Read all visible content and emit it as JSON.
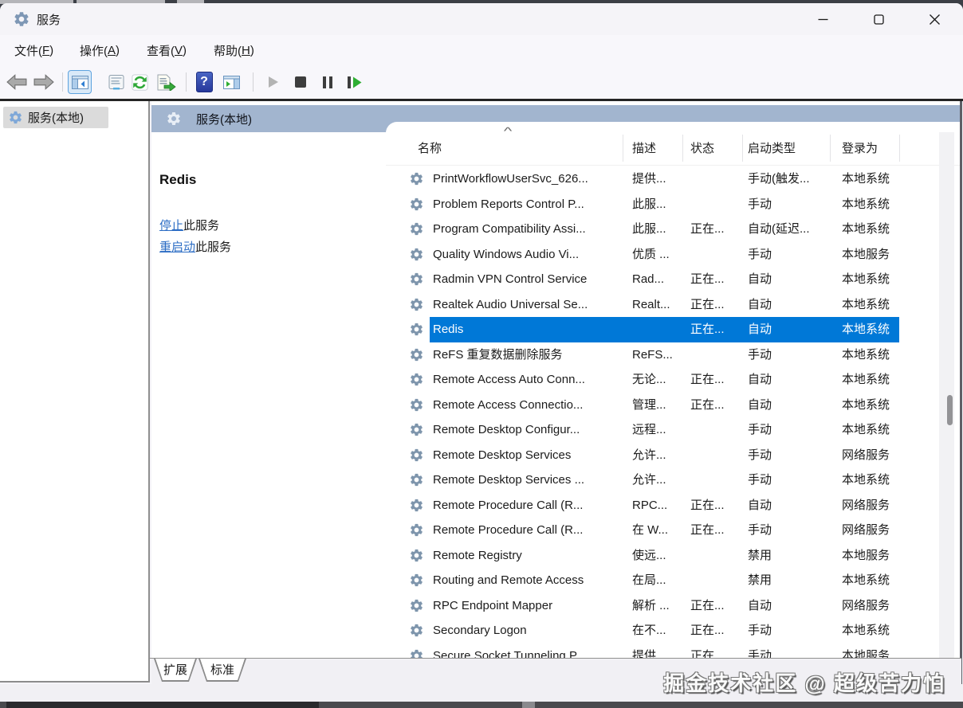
{
  "window": {
    "title": "服务",
    "controls": [
      {
        "name": "minimize"
      },
      {
        "name": "maximize"
      },
      {
        "name": "close"
      }
    ]
  },
  "menu": {
    "items": [
      {
        "pre": "文件(",
        "key": "F",
        "post": ")"
      },
      {
        "pre": "操作(",
        "key": "A",
        "post": ")"
      },
      {
        "pre": "查看(",
        "key": "V",
        "post": ")"
      },
      {
        "pre": "帮助(",
        "key": "H",
        "post": ")"
      }
    ]
  },
  "toolbar": {
    "help_glyph": "?",
    "buttons": [
      {
        "name": "back",
        "enabled": true,
        "pressed": false
      },
      {
        "name": "forward",
        "enabled": true,
        "pressed": false
      },
      {
        "name": "show-console-tree",
        "enabled": true,
        "pressed": true
      },
      {
        "name": "properties",
        "enabled": true,
        "pressed": false
      },
      {
        "name": "refresh",
        "enabled": true,
        "pressed": false
      },
      {
        "name": "export-list",
        "enabled": true,
        "pressed": false
      },
      {
        "name": "help",
        "enabled": true,
        "pressed": false
      },
      {
        "name": "show-action-pane",
        "enabled": true,
        "pressed": false
      },
      {
        "name": "start-service",
        "enabled": false,
        "pressed": false
      },
      {
        "name": "stop-service",
        "enabled": true,
        "pressed": false
      },
      {
        "name": "pause-service",
        "enabled": true,
        "pressed": false
      },
      {
        "name": "restart-service",
        "enabled": true,
        "pressed": false
      }
    ]
  },
  "tree": {
    "root_label": "服务(本地)"
  },
  "pane_header": {
    "title": "服务(本地)"
  },
  "detail": {
    "service_name": "Redis",
    "actions": [
      {
        "link": "停止",
        "suffix": "此服务"
      },
      {
        "link": "重启动",
        "suffix": "此服务"
      }
    ]
  },
  "table": {
    "sort_indicator": "^",
    "columns": [
      "名称",
      "描述",
      "状态",
      "启动类型",
      "登录为"
    ],
    "rows": [
      {
        "name": "PrintWorkflowUserSvc_626...",
        "description": "提供...",
        "status": "",
        "startup_type": "手动(触发...",
        "logon_as": "本地系统",
        "selected": false
      },
      {
        "name": "Problem Reports Control P...",
        "description": "此服...",
        "status": "",
        "startup_type": "手动",
        "logon_as": "本地系统",
        "selected": false
      },
      {
        "name": "Program Compatibility Assi...",
        "description": "此服...",
        "status": "正在...",
        "startup_type": "自动(延迟...",
        "logon_as": "本地系统",
        "selected": false
      },
      {
        "name": "Quality Windows Audio Vi...",
        "description": "优质 ...",
        "status": "",
        "startup_type": "手动",
        "logon_as": "本地服务",
        "selected": false
      },
      {
        "name": "Radmin VPN Control Service",
        "description": "Rad...",
        "status": "正在...",
        "startup_type": "自动",
        "logon_as": "本地系统",
        "selected": false
      },
      {
        "name": "Realtek Audio Universal Se...",
        "description": "Realt...",
        "status": "正在...",
        "startup_type": "自动",
        "logon_as": "本地系统",
        "selected": false
      },
      {
        "name": "Redis",
        "description": "",
        "status": "正在...",
        "startup_type": "自动",
        "logon_as": "本地系统",
        "selected": true
      },
      {
        "name": "ReFS 重复数据删除服务",
        "description": "ReFS...",
        "status": "",
        "startup_type": "手动",
        "logon_as": "本地系统",
        "selected": false
      },
      {
        "name": "Remote Access Auto Conn...",
        "description": "无论...",
        "status": "正在...",
        "startup_type": "自动",
        "logon_as": "本地系统",
        "selected": false
      },
      {
        "name": "Remote Access Connectio...",
        "description": "管理...",
        "status": "正在...",
        "startup_type": "自动",
        "logon_as": "本地系统",
        "selected": false
      },
      {
        "name": "Remote Desktop Configur...",
        "description": "远程...",
        "status": "",
        "startup_type": "手动",
        "logon_as": "本地系统",
        "selected": false
      },
      {
        "name": "Remote Desktop Services",
        "description": "允许...",
        "status": "",
        "startup_type": "手动",
        "logon_as": "网络服务",
        "selected": false
      },
      {
        "name": "Remote Desktop Services ...",
        "description": "允许...",
        "status": "",
        "startup_type": "手动",
        "logon_as": "本地系统",
        "selected": false
      },
      {
        "name": "Remote Procedure Call (R...",
        "description": "RPC...",
        "status": "正在...",
        "startup_type": "自动",
        "logon_as": "网络服务",
        "selected": false
      },
      {
        "name": "Remote Procedure Call (R...",
        "description": "在 W...",
        "status": "正在...",
        "startup_type": "手动",
        "logon_as": "网络服务",
        "selected": false
      },
      {
        "name": "Remote Registry",
        "description": "使远...",
        "status": "",
        "startup_type": "禁用",
        "logon_as": "本地服务",
        "selected": false
      },
      {
        "name": "Routing and Remote Access",
        "description": "在局...",
        "status": "",
        "startup_type": "禁用",
        "logon_as": "本地系统",
        "selected": false
      },
      {
        "name": "RPC Endpoint Mapper",
        "description": "解析 ...",
        "status": "正在...",
        "startup_type": "自动",
        "logon_as": "网络服务",
        "selected": false
      },
      {
        "name": "Secondary Logon",
        "description": "在不...",
        "status": "正在...",
        "startup_type": "手动",
        "logon_as": "本地系统",
        "selected": false
      },
      {
        "name": "Secure Socket Tunneling P...",
        "description": "提供...",
        "status": "正在...",
        "startup_type": "手动",
        "logon_as": "本地服务",
        "selected": false
      }
    ]
  },
  "tabs": {
    "items": [
      {
        "label": "扩展",
        "selected": true
      },
      {
        "label": "标准",
        "selected": false
      }
    ]
  },
  "watermark": "掘金技术社区 @ 超级苦力怕",
  "colors": {
    "accent": "#0078d7",
    "header_band": "#a2b5cf",
    "link": "#2b6cc4"
  }
}
